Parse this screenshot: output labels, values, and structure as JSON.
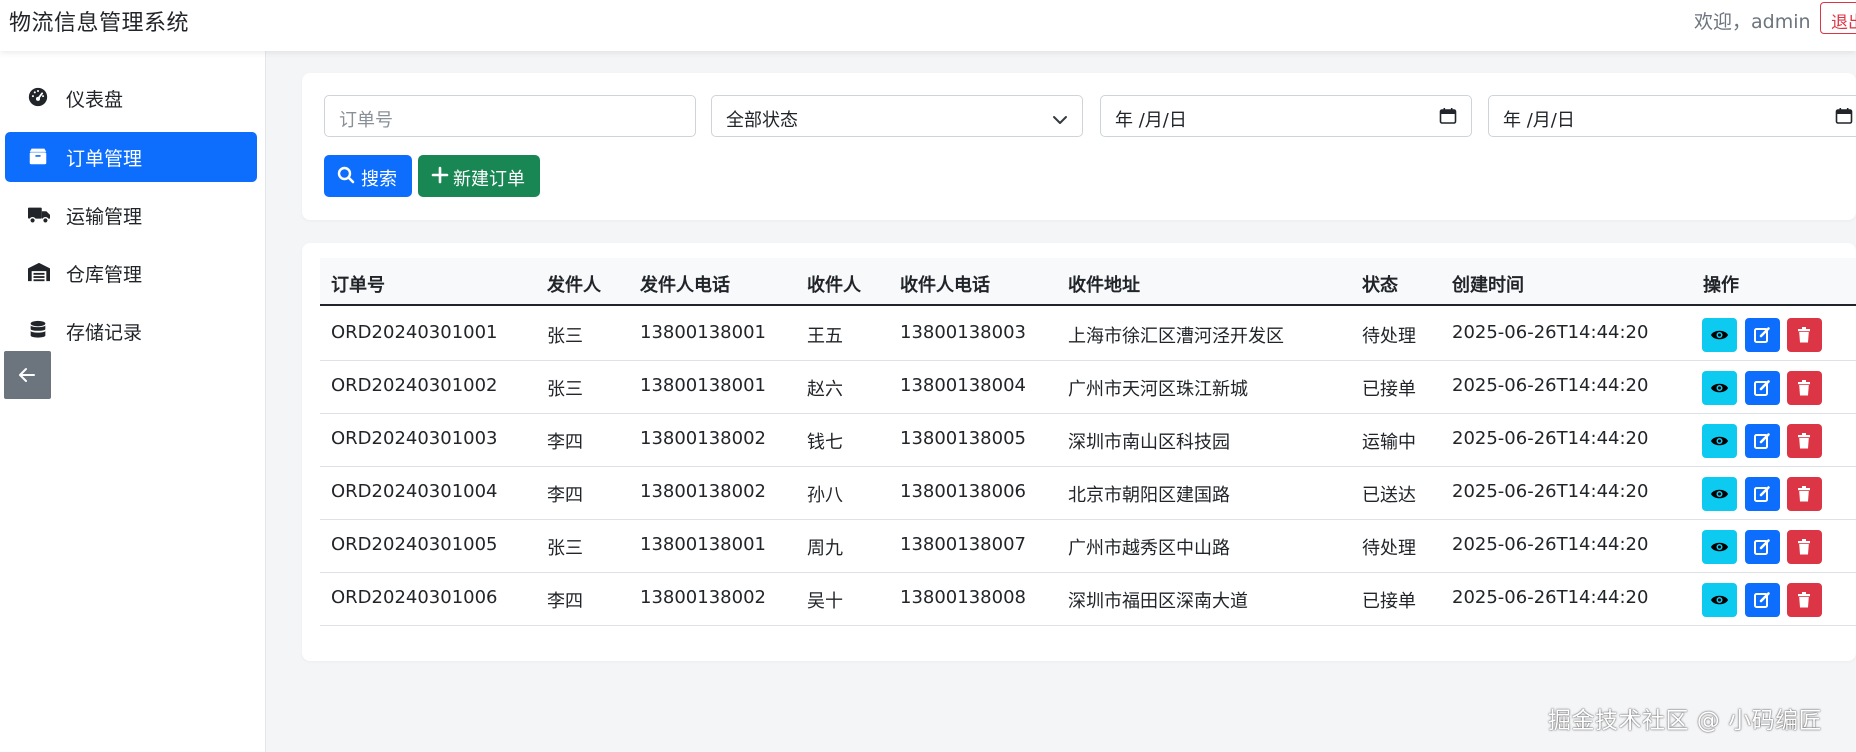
{
  "header": {
    "title": "物流信息管理系统",
    "welcome": "欢迎，admin",
    "logout_label": "退出"
  },
  "sidebar": {
    "items": [
      {
        "label": "仪表盘",
        "icon": "dashboard-gauge-icon"
      },
      {
        "label": "订单管理",
        "icon": "box-icon",
        "active": true
      },
      {
        "label": "运输管理",
        "icon": "truck-icon"
      },
      {
        "label": "仓库管理",
        "icon": "warehouse-icon"
      },
      {
        "label": "存储记录",
        "icon": "database-icon"
      }
    ],
    "collapse_icon": "arrow-left-icon"
  },
  "filters": {
    "order_placeholder": "订单号",
    "status_value": "全部状态",
    "date_start_placeholder": "年 /月/日",
    "date_end_placeholder": "年 /月/日",
    "search_label": "搜索",
    "new_label": "新建订单"
  },
  "table": {
    "columns": [
      "订单号",
      "发件人",
      "发件人电话",
      "收件人",
      "收件人电话",
      "收件地址",
      "状态",
      "创建时间",
      "操作"
    ],
    "rows": [
      [
        "ORD20240301001",
        "张三",
        "13800138001",
        "王五",
        "13800138003",
        "上海市徐汇区漕河泾开发区",
        "待处理",
        "2025-06-26T14:44:20"
      ],
      [
        "ORD20240301002",
        "张三",
        "13800138001",
        "赵六",
        "13800138004",
        "广州市天河区珠江新城",
        "已接单",
        "2025-06-26T14:44:20"
      ],
      [
        "ORD20240301003",
        "李四",
        "13800138002",
        "钱七",
        "13800138005",
        "深圳市南山区科技园",
        "运输中",
        "2025-06-26T14:44:20"
      ],
      [
        "ORD20240301004",
        "李四",
        "13800138002",
        "孙八",
        "13800138006",
        "北京市朝阳区建国路",
        "已送达",
        "2025-06-26T14:44:20"
      ],
      [
        "ORD20240301005",
        "张三",
        "13800138001",
        "周九",
        "13800138007",
        "广州市越秀区中山路",
        "待处理",
        "2025-06-26T14:44:20"
      ],
      [
        "ORD20240301006",
        "李四",
        "13800138002",
        "吴十",
        "13800138008",
        "深圳市福田区深南大道",
        "已接单",
        "2025-06-26T14:44:20"
      ]
    ],
    "action_icons": [
      "eye-icon",
      "edit-icon",
      "trash-icon"
    ]
  },
  "watermark": "掘金技术社区 @ 小码编匠",
  "colors": {
    "primary": "#0d6efd",
    "success": "#198754",
    "info": "#0dcaf0",
    "danger": "#dc3545",
    "secondary": "#6c757d"
  }
}
